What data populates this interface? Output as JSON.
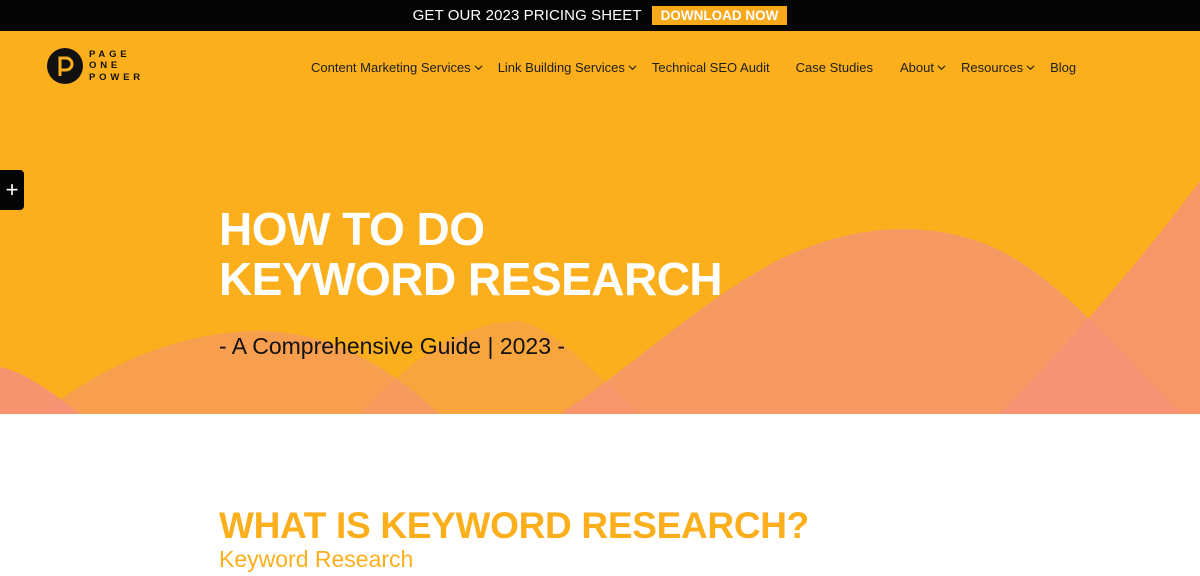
{
  "colors": {
    "accent": "#fbaf1c",
    "banner": "#050505",
    "wave": "#f6917a"
  },
  "topbar": {
    "text": "GET OUR 2023 PRICING SHEET",
    "button_label": "DOWNLOAD NOW"
  },
  "logo": {
    "lines": [
      "PAGE",
      "ONE",
      "POWER"
    ]
  },
  "nav": {
    "items": [
      {
        "label": "Content Marketing Services",
        "icon": "chevron-down-icon"
      },
      {
        "label": "Link Building Services",
        "icon": "chevron-down-icon"
      },
      {
        "label": "Technical SEO Audit"
      },
      {
        "label": "Case Studies"
      },
      {
        "label": "About",
        "icon": "chevron-down-icon"
      },
      {
        "label": "Resources",
        "icon": "chevron-down-icon"
      },
      {
        "label": "Blog"
      }
    ]
  },
  "side_toggle": {
    "icon": "plus-icon",
    "glyph": "+"
  },
  "hero": {
    "title_line1": "HOW TO DO",
    "title_line2": "KEYWORD RESEARCH",
    "subtitle": "- A Comprehensive Guide | 2023 -"
  },
  "content": {
    "heading": "WHAT IS KEYWORD RESEARCH?",
    "subheading": "Keyword Research"
  }
}
